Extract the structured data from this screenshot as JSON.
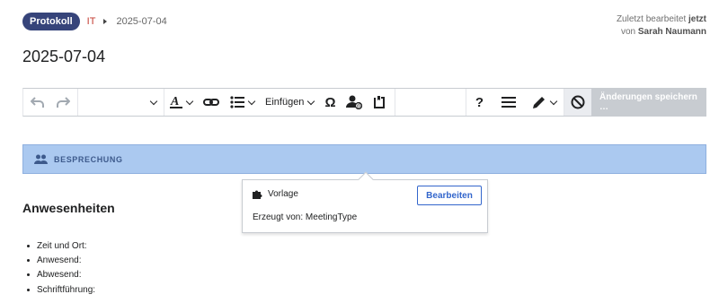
{
  "breadcrumb": {
    "badge": "Protokoll",
    "category": "IT",
    "date": "2025-07-04"
  },
  "edit_info": {
    "prefix": "Zuletzt bearbeitet",
    "when": "jetzt",
    "by_prefix": "von",
    "user": "Sarah Naumann"
  },
  "page": {
    "title": "2025-07-04"
  },
  "toolbar": {
    "insert_label": "Einfügen",
    "help_symbol": "?",
    "save_label": "Änderungen speichern …"
  },
  "banner": {
    "label": "BESPRECHUNG"
  },
  "popup": {
    "type_label": "Vorlage",
    "edit_button": "Bearbeiten",
    "generated_by": "Erzeugt von: MeetingType"
  },
  "content": {
    "heading": "Anwesenheiten",
    "items": [
      "Zeit und Ort:",
      "Anwesend:",
      "Abwesend:",
      "Schriftführung:"
    ]
  },
  "colors": {
    "badge": "#36447a",
    "category": "#c33a2f",
    "banner": "#abc9f0",
    "accent": "#3366cc"
  }
}
